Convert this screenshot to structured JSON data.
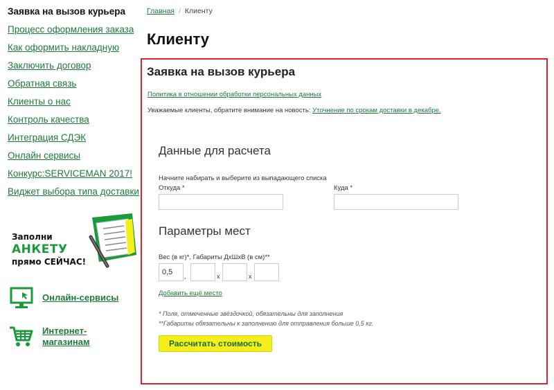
{
  "sidebar": {
    "title": "Заявка на вызов курьера",
    "items": [
      {
        "label": "Процесс оформления заказа"
      },
      {
        "label": "Как оформить накладную"
      },
      {
        "label": "Заключить договор"
      },
      {
        "label": "Обратная связь"
      },
      {
        "label": "Клиенты о нас"
      },
      {
        "label": "Контроль качества"
      },
      {
        "label": "Интеграция СДЭК"
      },
      {
        "label": "Онлайн сервисы"
      },
      {
        "label": "Конкурс:SERVICEMAN 2017!"
      },
      {
        "label": "Виджет выбора типа доставки"
      }
    ]
  },
  "promo": {
    "line1": "Заполни",
    "line2": "АНКЕТУ",
    "line3": "прямо СЕЙЧАС!"
  },
  "services": {
    "online": "Онлайн-сервисы",
    "shops": "Интернет-магазинам"
  },
  "breadcrumb": {
    "home": "Главная",
    "separator": "/",
    "current": "Клиенту"
  },
  "page": {
    "title": "Клиенту"
  },
  "form": {
    "title": "Заявка на вызов курьера",
    "policy_link": "Политика в отношении обработки персональных данных",
    "notice_text": "Уважаемые клиенты, обратите внимание на новость: ",
    "notice_link": "Уточнение по срокам доставки в декабре.",
    "section_calc": "Данные для расчета",
    "hint": "Начните набирать и выберите из выпадающего списка",
    "from_label": "Откуда *",
    "to_label": "Куда *",
    "from_value": "",
    "to_value": "",
    "section_places": "Параметры мест",
    "weight_label": "Вес (в кг)*, Габариты ДхШхВ (в см)**",
    "weight_value": "0,5",
    "length_value": "",
    "width_value": "",
    "height_value": "",
    "sep_comma": ",",
    "sep_x": "x",
    "add_place": "Добавить ещё место",
    "footnote1": "* Поля, отмеченные звёздочкой, обязательны для заполнения",
    "footnote2": "**Габариты обязательны к заполнению для отправления больше 0,5 кг.",
    "calc_button": "Рассчитать стоимость"
  },
  "colors": {
    "link": "#1d7b3a",
    "accent_green": "#1a9a3a",
    "border_red": "#d9232d",
    "button_yellow": "#f4ef1a"
  }
}
